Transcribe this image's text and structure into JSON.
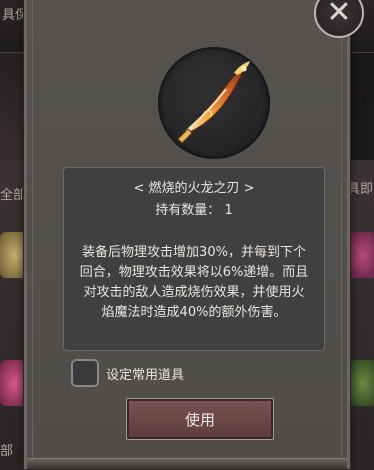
{
  "background": {
    "top_left_text": "具保存",
    "left_tab_text": "全部",
    "right_tab_text": "具即",
    "bottom_left_text": "部"
  },
  "dialog": {
    "close_icon": "close-x-icon",
    "item_icon": "flame-dragon-blade-icon",
    "item_name": "< 燃烧的火龙之刃 >",
    "count_label": "持有数量：",
    "count_value": "1",
    "description": "装备后物理攻击增加30%，并每到下个回合，物理攻击效果将以6%递增。而且对攻击的敌人造成烧伤效果，并使用火焰魔法时造成40%的额外伤害。",
    "favorite_label": "设定常用道具",
    "favorite_checked": false,
    "use_button_label": "使用"
  },
  "colors": {
    "dialog_bg": "#56534f",
    "desc_bg": "#3f4042",
    "use_button": "#6e4848",
    "text": "#ece6de"
  }
}
